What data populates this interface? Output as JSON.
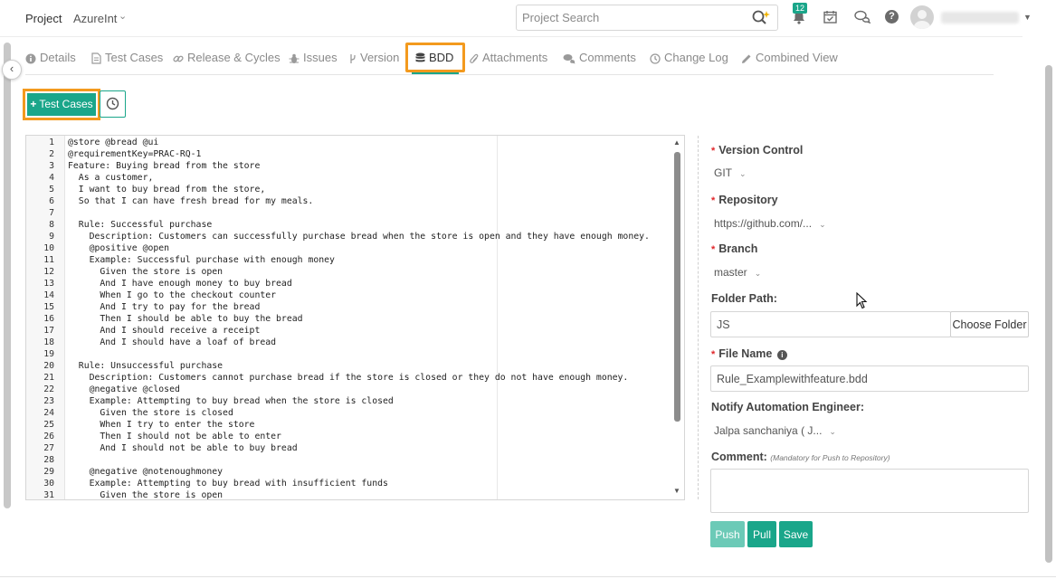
{
  "header": {
    "project_label": "Project",
    "project_name": "AzureInt",
    "search_placeholder": "Project Search",
    "notification_count": "12"
  },
  "tabs": [
    {
      "label": "Details",
      "icon": "info-circle-icon"
    },
    {
      "label": "Test Cases",
      "icon": "file-icon"
    },
    {
      "label": "Release & Cycles",
      "icon": "link-icon"
    },
    {
      "label": "Issues",
      "icon": "bug-icon"
    },
    {
      "label": "Version",
      "icon": "branch-icon"
    },
    {
      "label": "BDD",
      "icon": "database-icon",
      "active": true
    },
    {
      "label": "Attachments",
      "icon": "paperclip-icon"
    },
    {
      "label": "Comments",
      "icon": "comments-icon"
    },
    {
      "label": "Change Log",
      "icon": "clock-icon"
    },
    {
      "label": "Combined View",
      "icon": "pencil-icon"
    }
  ],
  "toolbar": {
    "test_cases_label": "Test Cases"
  },
  "editor": {
    "lines": [
      "@store @bread @ui",
      "@requirementKey=PRAC-RQ-1",
      "Feature: Buying bread from the store",
      "  As a customer,",
      "  I want to buy bread from the store,",
      "  So that I can have fresh bread for my meals.",
      "",
      "  Rule: Successful purchase",
      "    Description: Customers can successfully purchase bread when the store is open and they have enough money.",
      "    @positive @open",
      "    Example: Successful purchase with enough money",
      "      Given the store is open",
      "      And I have enough money to buy bread",
      "      When I go to the checkout counter",
      "      And I try to pay for the bread",
      "      Then I should be able to buy the bread",
      "      And I should receive a receipt",
      "      And I should have a loaf of bread",
      "",
      "  Rule: Unsuccessful purchase",
      "    Description: Customers cannot purchase bread if the store is closed or they do not have enough money.",
      "    @negative @closed",
      "    Example: Attempting to buy bread when the store is closed",
      "      Given the store is closed",
      "      When I try to enter the store",
      "      Then I should not be able to enter",
      "      And I should not be able to buy bread",
      "",
      "    @negative @notenoughmoney",
      "    Example: Attempting to buy bread with insufficient funds",
      "      Given the store is open"
    ]
  },
  "form": {
    "version_control": {
      "label": "Version Control",
      "value": "GIT"
    },
    "repository": {
      "label": "Repository",
      "value": "https://github.com/..."
    },
    "branch": {
      "label": "Branch",
      "value": "master"
    },
    "folder_path": {
      "label": "Folder Path:",
      "value": "JS",
      "button": "Choose Folder"
    },
    "file_name": {
      "label": "File Name",
      "value": "Rule_Examplewithfeature.bdd"
    },
    "notify": {
      "label": "Notify Automation Engineer:",
      "value": "Jalpa sanchaniya ( J..."
    },
    "comment": {
      "label": "Comment:",
      "hint": "(Mandatory for Push to Repository)"
    },
    "buttons": {
      "push": "Push",
      "pull": "Pull",
      "save": "Save"
    }
  },
  "colors": {
    "accent": "#1aa68a",
    "highlight": "#f39a1e",
    "required": "#e0262a"
  }
}
